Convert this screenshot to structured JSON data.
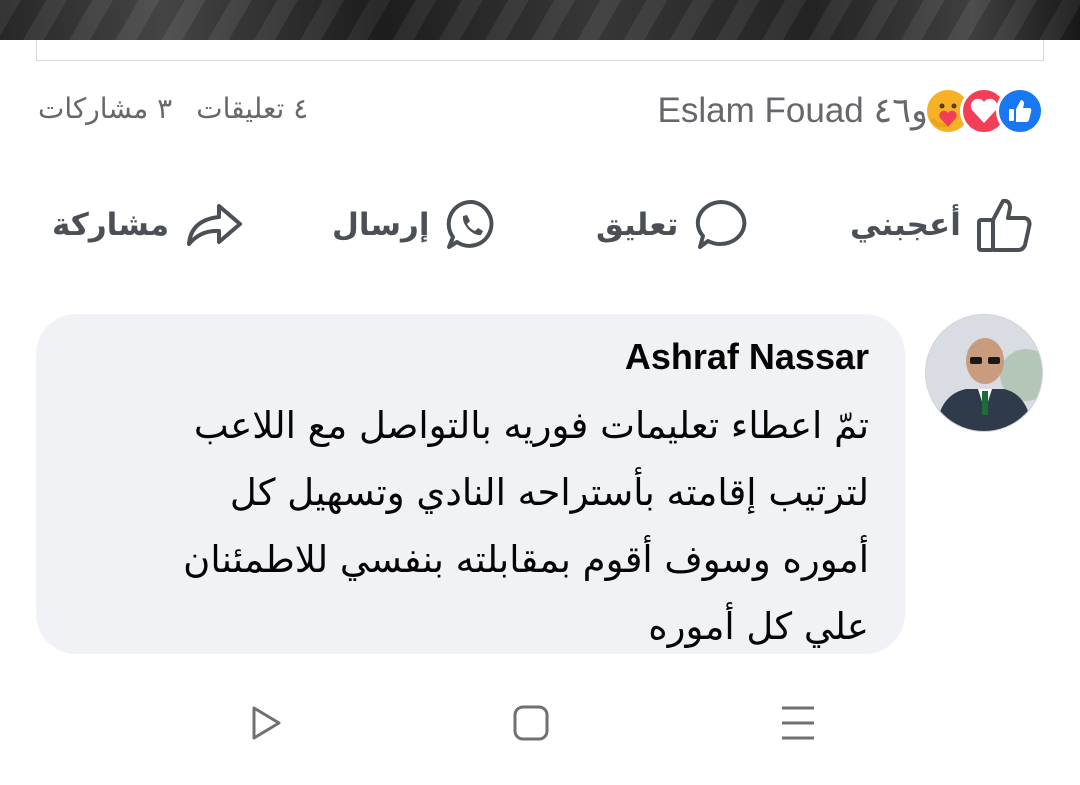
{
  "post": {
    "comments_count": "٤ تعليقات",
    "shares_count": "٣ مشاركات",
    "reaction_summary": "Eslam Fouad و٤٦",
    "reaction_types": [
      "like",
      "love",
      "care"
    ],
    "colors": {
      "like": "#1877f2",
      "love": "#f33e58",
      "care": "#f7b125",
      "meta_text": "#65676b"
    }
  },
  "actions": {
    "like_label": "أعجبني",
    "comment_label": "تعليق",
    "send_label": "إرسال",
    "share_label": "مشاركة"
  },
  "comment": {
    "author": "Ashraf Nassar",
    "lines": [
      "تمّ اعطاء تعليمات فوريه بالتواصل مع اللاعب",
      "لترتيب إقامته بأستراحه النادي وتسهيل كل",
      "أموره وسوف أقوم بمقابلته بنفسي للاطمئنان",
      "علي كل أموره"
    ],
    "bubble_color": "#f0f2f5"
  },
  "nav": {
    "icons": [
      "back-icon",
      "home-icon",
      "recent-apps-icon"
    ]
  }
}
